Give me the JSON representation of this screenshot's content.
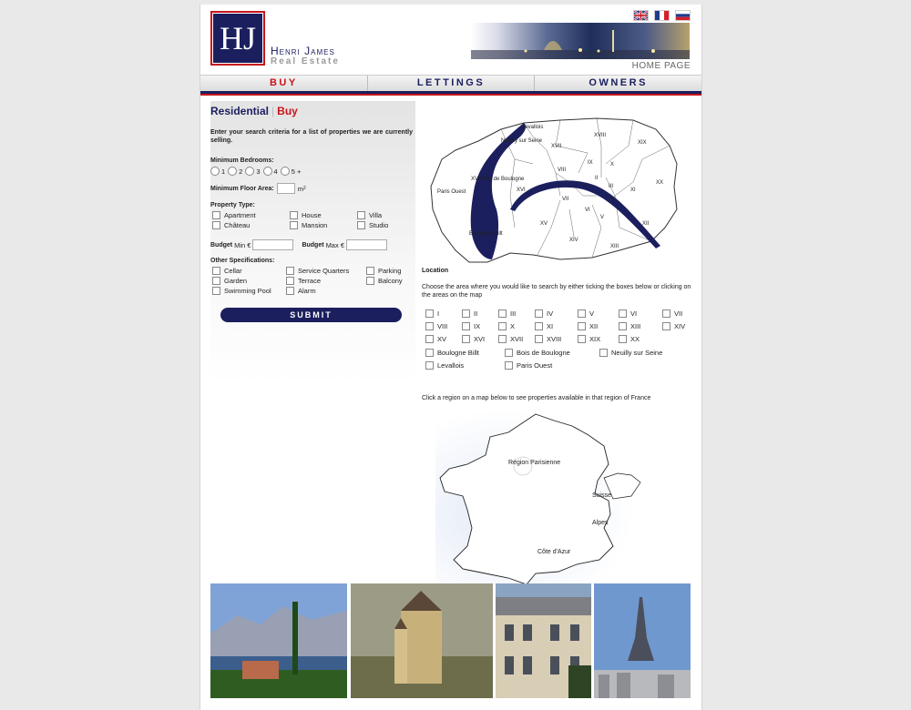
{
  "header": {
    "logo_letters": "HJ",
    "company_name": "Henri James",
    "company_tagline": "Real Estate",
    "home_page_link": "HOME PAGE",
    "flags": [
      "uk-flag-icon",
      "france-flag-icon",
      "russia-flag-icon"
    ]
  },
  "nav": {
    "items": [
      "BUY",
      "LETTINGS",
      "OWNERS"
    ],
    "active": "BUY"
  },
  "search": {
    "title_part1": "Residential",
    "title_sep": "|",
    "title_part2": "Buy",
    "intro": "Enter your search criteria for a list of properties we are currently selling.",
    "min_bedrooms_label": "Minimum Bedrooms:",
    "bedroom_options": [
      "1",
      "2",
      "3",
      "4",
      "5 +"
    ],
    "min_floor_area_label": "Minimum Floor Area:",
    "floor_area_unit": "m",
    "floor_area_unit_sup": "2",
    "property_type_label": "Property Type:",
    "property_types": [
      "Apartment",
      "House",
      "Villa",
      "Château",
      "Mansion",
      "Studio"
    ],
    "budget_label": "Budget",
    "budget_min_label": "Min €",
    "budget_max_label": "Max €",
    "other_specs_label": "Other Specifications:",
    "other_specs": [
      "Cellar",
      "Service Quarters",
      "Parking",
      "Garden",
      "Terrace",
      "Balcony",
      "Swimming Pool",
      "Alarm"
    ],
    "submit_label": "SUBMIT"
  },
  "paris_map": {
    "labels": [
      "Levallois",
      "Neuilly sur Seine",
      "XVII",
      "XVIII",
      "XIX",
      "IX",
      "X",
      "VIII",
      "XX",
      "II",
      "XVI Bois de Boulogne",
      "XVI",
      "Paris Ouest",
      "I",
      "III",
      "XI",
      "VII",
      "VI",
      "IV",
      "V",
      "XII",
      "XV",
      "Boulogne Billt",
      "XIV",
      "XIII"
    ]
  },
  "location": {
    "heading": "Location",
    "instruction": "Choose the area where you would like to search by either ticking the boxes below or clicking on the areas on the map",
    "arrondissements": [
      "I",
      "II",
      "III",
      "IV",
      "V",
      "VI",
      "VII",
      "VIII",
      "IX",
      "X",
      "XI",
      "XII",
      "XIII",
      "XIV",
      "XV",
      "XVI",
      "XVII",
      "XVIII",
      "XIX",
      "XX"
    ],
    "extra_areas": [
      "Boulogne Billt",
      "Bois de Boulogne",
      "Neuilly sur Seine",
      "Levallois",
      "Paris Ouest"
    ]
  },
  "france_map": {
    "instruction": "Click a region on a map below to see properties available in that region of France",
    "regions": [
      "Région Parisienne",
      "Suisse",
      "Alpes",
      "Côte d'Azur"
    ]
  },
  "photos": [
    "lake-village-photo",
    "chateau-photo",
    "paris-building-photo",
    "eiffel-tower-photo"
  ],
  "colors": {
    "navy": "#1b1f5e",
    "red": "#c7141b",
    "background": "#e9e9e9"
  }
}
